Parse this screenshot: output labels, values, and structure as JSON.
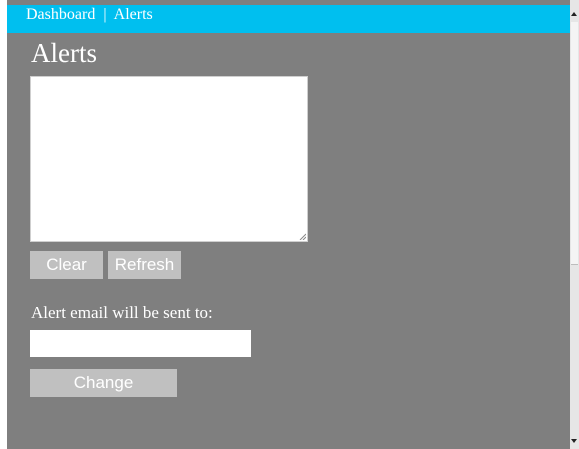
{
  "header": {
    "breadcrumb_root": "Dashboard",
    "breadcrumb_separator": "|",
    "breadcrumb_current": "Alerts",
    "bar_color": "#00bfef"
  },
  "page": {
    "title": "Alerts",
    "background_color": "#7f7f7f"
  },
  "alerts_box": {
    "value": ""
  },
  "actions": {
    "clear_label": "Clear",
    "refresh_label": "Refresh"
  },
  "email": {
    "label": "Alert email will be sent to:",
    "value": "",
    "change_label": "Change"
  },
  "icons": {
    "resize_grip": "resize-grip-icon",
    "scroll_up": "chevron-up-icon",
    "scroll_down": "chevron-down-icon"
  }
}
